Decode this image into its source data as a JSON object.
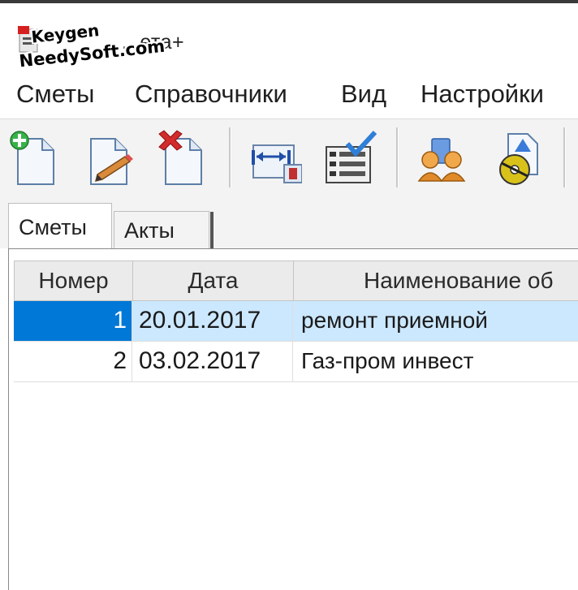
{
  "window": {
    "title": "...ета+"
  },
  "watermark": {
    "line1": "Keygen",
    "line2": "NeedySoft.com"
  },
  "menu": {
    "items": [
      "Сметы",
      "Справочники",
      "Вид",
      "Настройки"
    ]
  },
  "toolbar": {
    "buttons": [
      {
        "icon": "new-document-icon"
      },
      {
        "icon": "edit-document-icon"
      },
      {
        "icon": "delete-document-icon"
      },
      {
        "icon": "column-width-icon"
      },
      {
        "icon": "checklist-icon"
      },
      {
        "icon": "people-icon"
      },
      {
        "icon": "cd-document-icon"
      }
    ]
  },
  "tabs": [
    {
      "label": "Сметы",
      "active": true
    },
    {
      "label": "Акты",
      "active": false
    }
  ],
  "table": {
    "columns": [
      "Номер",
      "Дата",
      "Наименование об"
    ],
    "rows": [
      {
        "num": "1",
        "date": "20.01.2017",
        "name": "ремонт приемной",
        "selected": true
      },
      {
        "num": "2",
        "date": "03.02.2017",
        "name": "Газ-пром инвест",
        "selected": false
      }
    ]
  },
  "colors": {
    "selection": "#0078d7",
    "selection_light": "#cce8ff"
  }
}
